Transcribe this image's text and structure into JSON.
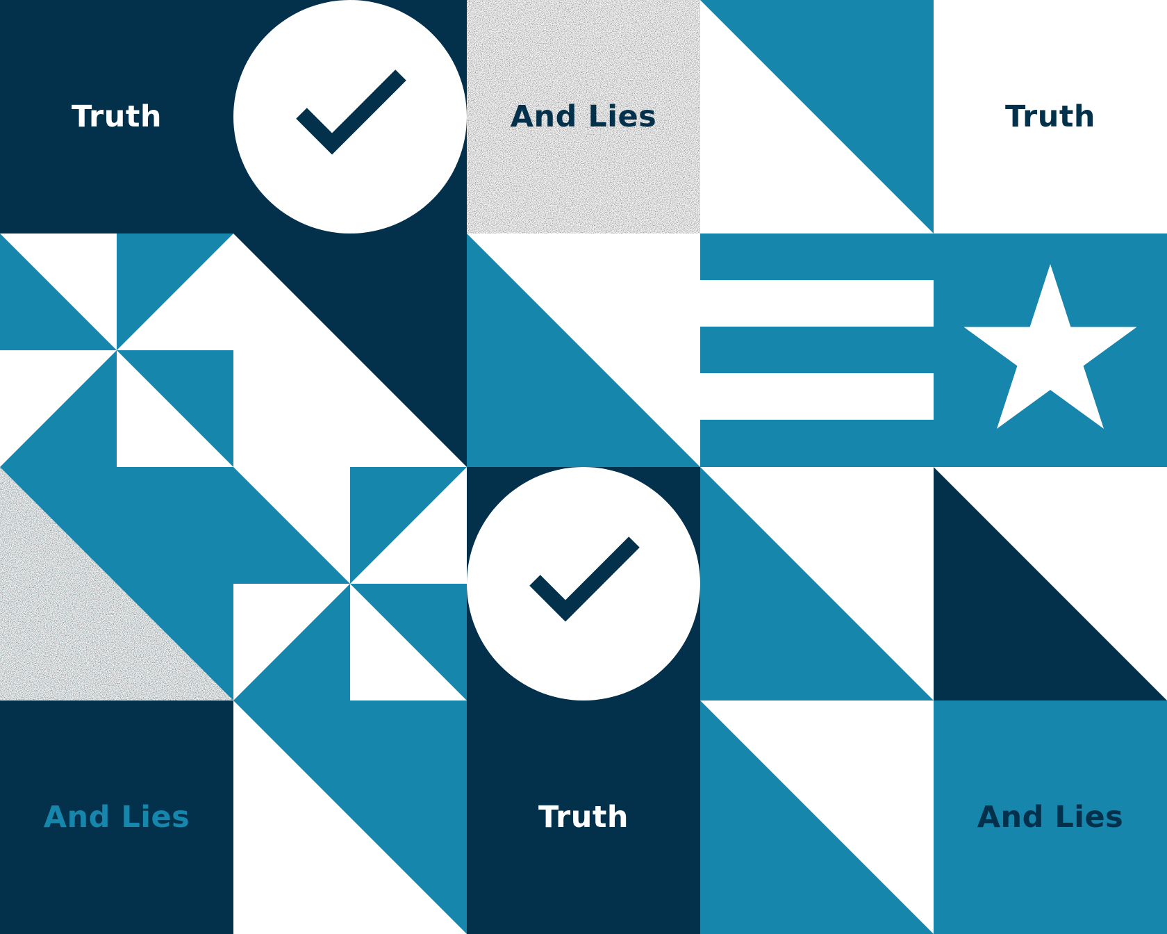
{
  "colors": {
    "navy": "#03304a",
    "blue": "#1686ad",
    "white": "#ffffff",
    "texture_gray": "#e2e2e2"
  },
  "tiles": {
    "r0c0": {
      "text": "Truth",
      "text_color": "#ffffff",
      "background": "#03304a"
    },
    "r0c2": {
      "text": "And Lies",
      "text_color": "#03304a",
      "background": "textured-gray"
    },
    "r0c4": {
      "text": "Truth",
      "text_color": "#03304a",
      "background": "#ffffff"
    },
    "r3c0": {
      "text": "And Lies",
      "text_color": "#1686ad",
      "background": "#03304a"
    },
    "r3c2": {
      "text": "Truth",
      "text_color": "#ffffff",
      "background": "#03304a"
    },
    "r3c4": {
      "text": "And Lies",
      "text_color": "#03304a",
      "background": "textured-blue"
    }
  },
  "icons": [
    "check-circle-icon",
    "check-circle-icon",
    "star-icon",
    "flag-stripes"
  ]
}
